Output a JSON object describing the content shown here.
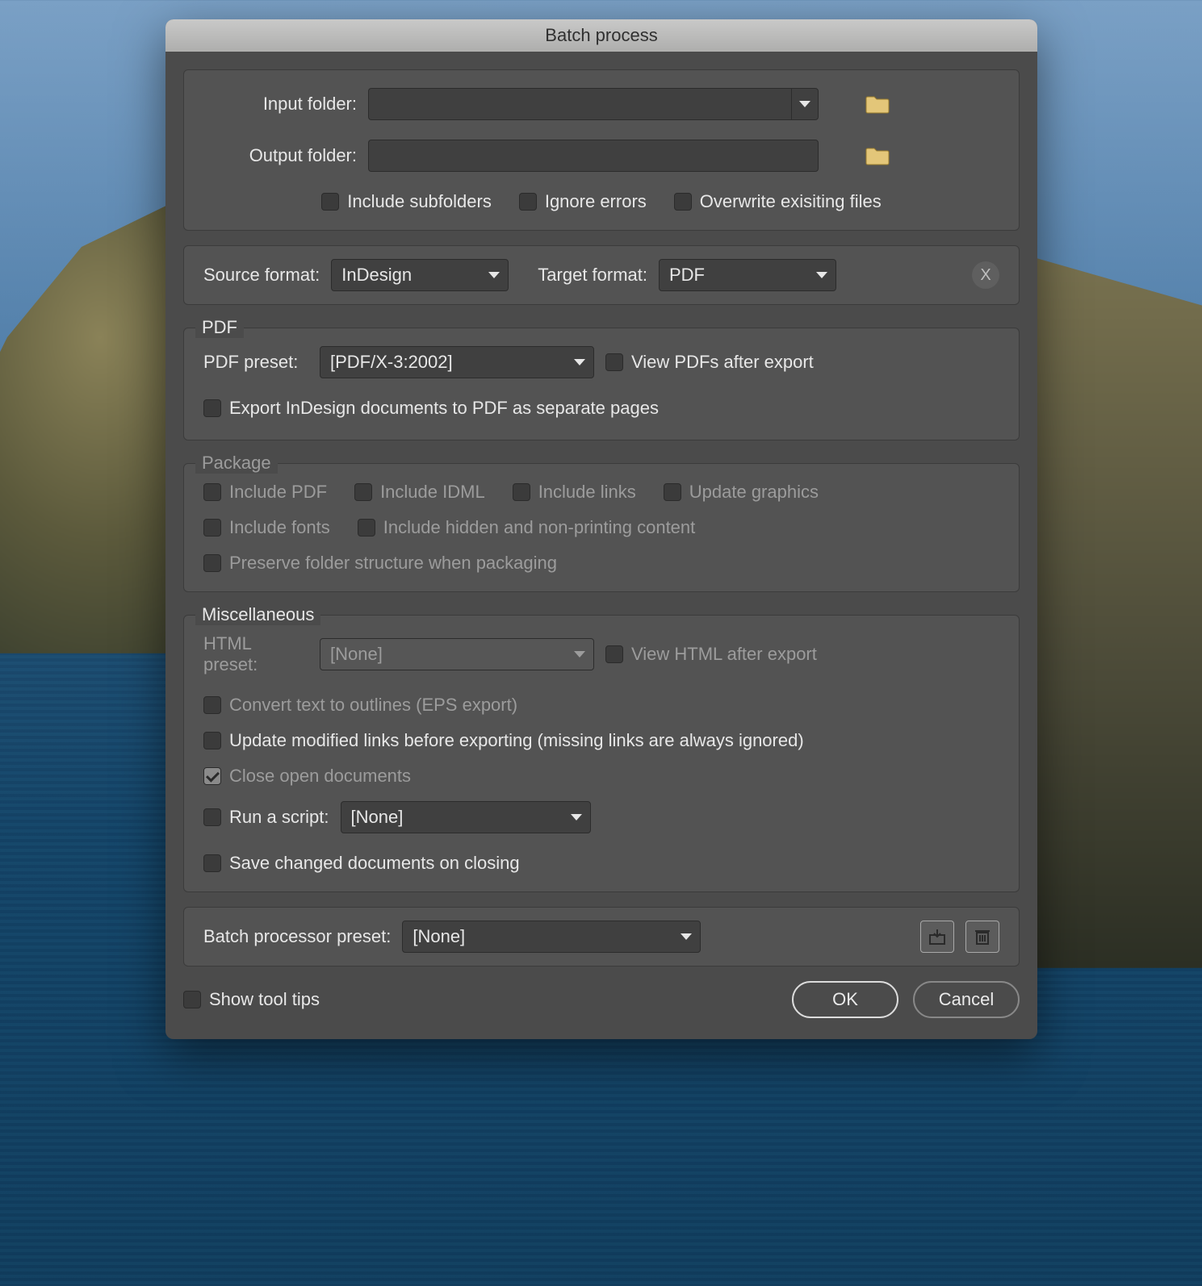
{
  "window": {
    "title": "Batch process"
  },
  "folders": {
    "input_label": "Input folder:",
    "output_label": "Output folder:",
    "include_subfolders": "Include subfolders",
    "ignore_errors": "Ignore errors",
    "overwrite": "Overwrite exisiting files"
  },
  "formats": {
    "source_label": "Source format:",
    "source_value": "InDesign",
    "target_label": "Target format:",
    "target_value": "PDF",
    "clear_label": "X"
  },
  "pdf": {
    "legend": "PDF",
    "preset_label": "PDF preset:",
    "preset_value": "[PDF/X-3:2002]",
    "view_after": "View PDFs after export",
    "separate_pages": "Export InDesign documents to PDF as separate pages"
  },
  "package": {
    "legend": "Package",
    "include_pdf": "Include PDF",
    "include_idml": "Include IDML",
    "include_links": "Include links",
    "update_graphics": "Update graphics",
    "include_fonts": "Include fonts",
    "include_hidden": "Include hidden and non-printing content",
    "preserve": "Preserve folder structure when packaging"
  },
  "misc": {
    "legend": "Miscellaneous",
    "html_preset_label": "HTML preset:",
    "html_preset_value": "[None]",
    "view_html": "View HTML after export",
    "convert_outlines": "Convert text to outlines (EPS export)",
    "update_links": "Update modified links before exporting (missing links are always ignored)",
    "close_open": "Close open documents",
    "run_script_label": "Run a script:",
    "run_script_value": "[None]",
    "save_changed": "Save changed documents on closing"
  },
  "preset_row": {
    "label": "Batch processor preset:",
    "value": "[None]"
  },
  "footer": {
    "show_tips": "Show tool tips",
    "ok": "OK",
    "cancel": "Cancel"
  }
}
